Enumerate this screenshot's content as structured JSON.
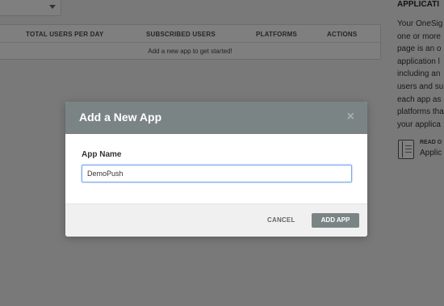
{
  "apps_table": {
    "columns": [
      "TOTAL USERS PER DAY",
      "SUBSCRIBED USERS",
      "PLATFORMS",
      "ACTIONS"
    ],
    "empty_message": "Add a new app to get started!"
  },
  "side_panel": {
    "title": "APPLICATI",
    "lines": [
      "Your OneSig",
      "one or more",
      "page is an o",
      "application l",
      "including an",
      "users and su",
      "each app as",
      "platforms tha",
      "your applica"
    ],
    "read_label": "READ O",
    "read_link": "Applic"
  },
  "modal": {
    "title": "Add a New App",
    "close_glyph": "×",
    "field_label": "App Name",
    "field_value": "DemoPush",
    "cancel_label": "CANCEL",
    "submit_label": "ADD APP"
  },
  "colors": {
    "overlay": "#000000",
    "modal_header": "#7b8485",
    "primary_button": "#7b8485",
    "input_focus": "#7aa6e8"
  },
  "icons": {
    "select_caret": "chevron-down-icon",
    "doc": "document-icon",
    "close": "close-icon"
  }
}
